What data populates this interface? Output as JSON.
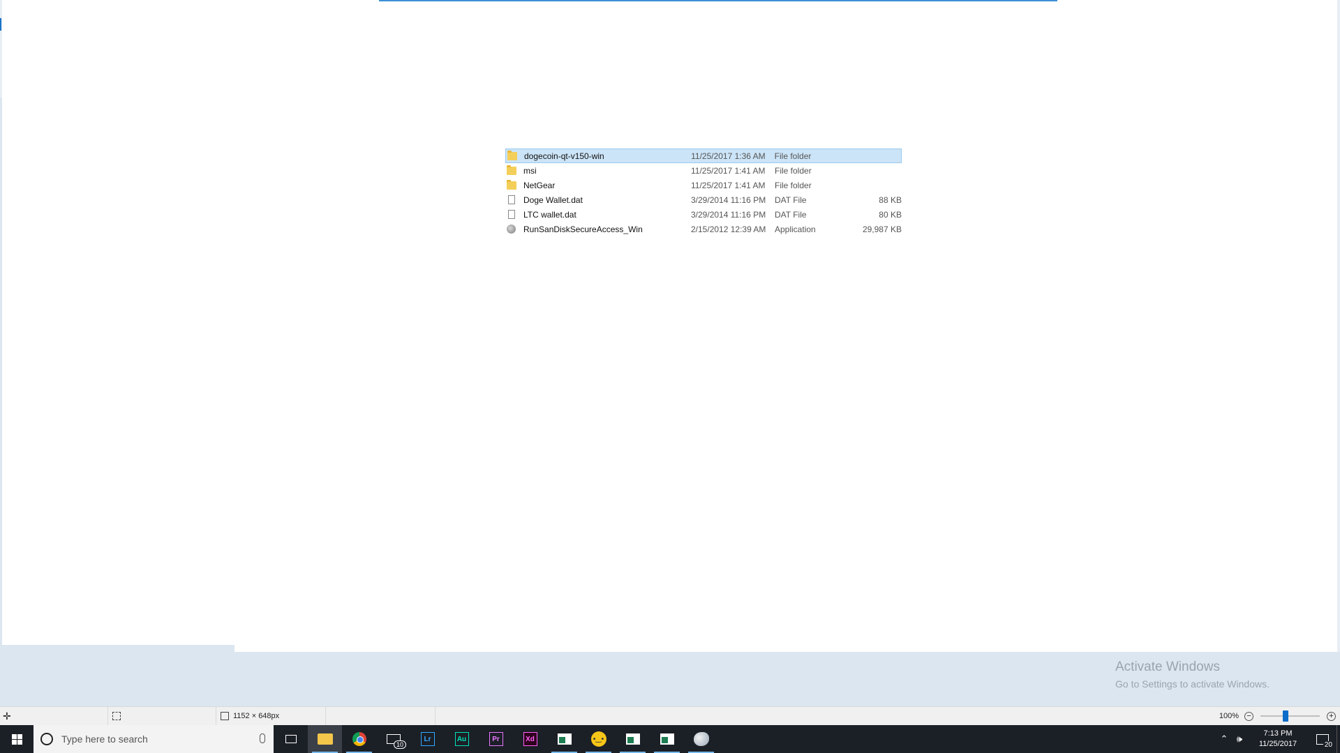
{
  "files": [
    {
      "name": "dogecoin-qt-v150-win",
      "date": "11/25/2017 1:36 AM",
      "type": "File folder",
      "size": "",
      "icon": "folder-icon",
      "selected": true
    },
    {
      "name": "msi",
      "date": "11/25/2017 1:41 AM",
      "type": "File folder",
      "size": "",
      "icon": "folder-icon",
      "selected": false
    },
    {
      "name": "NetGear",
      "date": "11/25/2017 1:41 AM",
      "type": "File folder",
      "size": "",
      "icon": "folder-icon",
      "selected": false
    },
    {
      "name": "Doge Wallet.dat",
      "date": "3/29/2014 11:16 PM",
      "type": "DAT File",
      "size": "88 KB",
      "icon": "file-icon",
      "selected": false
    },
    {
      "name": "LTC wallet.dat",
      "date": "3/29/2014 11:16 PM",
      "type": "DAT File",
      "size": "80 KB",
      "icon": "file-icon",
      "selected": false
    },
    {
      "name": "RunSanDiskSecureAccess_Win",
      "date": "2/15/2012 12:39 AM",
      "type": "Application",
      "size": "29,987 KB",
      "icon": "app-icon",
      "selected": false
    }
  ],
  "watermark": {
    "title": "Activate Windows",
    "subtitle": "Go to Settings to activate Windows."
  },
  "statusbar": {
    "image_size": "1152 × 648px",
    "zoom": "100%",
    "zoom_fraction": 0.42
  },
  "taskbar": {
    "search_placeholder": "Type here to search",
    "mail_badge": "10",
    "apps": [
      {
        "name": "task-view",
        "label": ""
      },
      {
        "name": "file-explorer",
        "label": ""
      },
      {
        "name": "chrome",
        "label": ""
      },
      {
        "name": "mail",
        "label": ""
      },
      {
        "name": "lightroom",
        "label": "Lr",
        "color": "#31a8ff"
      },
      {
        "name": "audition",
        "label": "Au",
        "color": "#00e4bb"
      },
      {
        "name": "premiere",
        "label": "Pr",
        "color": "#ea77ff"
      },
      {
        "name": "xd",
        "label": "Xd",
        "color": "#ff61f6"
      }
    ],
    "clock_time": "7:13 PM",
    "clock_date": "11/25/2017",
    "notification_count": "20"
  }
}
